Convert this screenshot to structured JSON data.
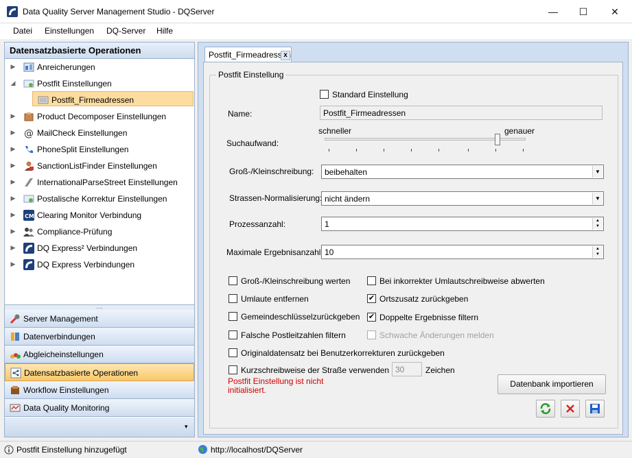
{
  "window": {
    "title": "Data Quality Server Management Studio - DQServer",
    "minimize": "—",
    "maximize": "☐",
    "close": "✕"
  },
  "menu": [
    "Datei",
    "Einstellungen",
    "DQ-Server",
    "Hilfe"
  ],
  "left": {
    "header": "Datensatzbasierte Operationen",
    "tree": [
      {
        "label": "Anreicherungen",
        "icon": "enrichment-icon",
        "expanded": false
      },
      {
        "label": "Postfit Einstellungen",
        "icon": "postfit-icon",
        "expanded": true
      },
      {
        "label": "Postfit_Firmeadressen",
        "icon": "document-icon",
        "child": true,
        "selected": true
      },
      {
        "label": "Product Decomposer Einstellungen",
        "icon": "product-icon",
        "expanded": false
      },
      {
        "label": "MailCheck Einstellungen",
        "icon": "at-icon",
        "expanded": false
      },
      {
        "label": "PhoneSplit Einstellungen",
        "icon": "phone-icon",
        "expanded": false
      },
      {
        "label": "SanctionListFinder Einstellungen",
        "icon": "person-icon",
        "expanded": false
      },
      {
        "label": "InternationalParseStreet Einstellungen",
        "icon": "street-icon",
        "expanded": false
      },
      {
        "label": "Postalische Korrektur Einstellungen",
        "icon": "postal-icon",
        "expanded": false
      },
      {
        "label": "Clearing Monitor Verbindung",
        "icon": "cm-icon",
        "expanded": false
      },
      {
        "label": "Compliance-Prüfung",
        "icon": "users-icon",
        "expanded": false
      },
      {
        "label": "DQ Express² Verbindungen",
        "icon": "dq-express-icon",
        "expanded": false
      },
      {
        "label": "DQ Express Verbindungen",
        "icon": "dq-express-icon",
        "expanded": false
      }
    ],
    "splitter": "....",
    "nav": [
      {
        "label": "Server Management",
        "icon": "wrench-icon",
        "selected": false
      },
      {
        "label": "Datenverbindungen",
        "icon": "database-icon",
        "selected": false
      },
      {
        "label": "Abgleicheinstellungen",
        "icon": "compare-icon",
        "selected": false
      },
      {
        "label": "Datensatzbasierte Operationen",
        "icon": "record-ops-icon",
        "selected": true
      },
      {
        "label": "Workflow Einstellungen",
        "icon": "workflow-icon",
        "selected": false
      },
      {
        "label": "Data Quality Monitoring",
        "icon": "monitoring-icon",
        "selected": false
      }
    ],
    "nav_more": "▾"
  },
  "tab": {
    "label": "Postfit_Firmeadressen",
    "close": "x"
  },
  "form": {
    "group_title": "Postfit Einstellung",
    "standard_label": "Standard Einstellung",
    "standard_checked": false,
    "name_label": "Name:",
    "name_value": "Postfit_Firmeadressen",
    "effort_label": "Suchaufwand:",
    "slider_left": "schneller",
    "slider_right": "genauer",
    "slider_value": 0.86,
    "case_label": "Groß-/Kleinschreibung:",
    "case_value": "beibehalten",
    "street_label": "Strassen-Normalisierung:",
    "street_value": "nicht ändern",
    "process_label": "Prozessanzahl:",
    "process_value": "1",
    "max_label": "Maximale Ergebnisanzahl:",
    "max_value": "10",
    "checks": [
      {
        "label": "Groß-/Kleinschreibung werten",
        "checked": false,
        "disabled": false
      },
      {
        "label": "Bei inkorrekter Umlautschreibweise abwerten",
        "checked": false,
        "disabled": false
      },
      {
        "label": "Umlaute entfernen",
        "checked": false,
        "disabled": false
      },
      {
        "label": "Ortszusatz zurückgeben",
        "checked": true,
        "disabled": false
      },
      {
        "label": "Gemeindeschlüsselzurückgeben",
        "checked": false,
        "disabled": false
      },
      {
        "label": "Doppelte Ergebnisse filtern",
        "checked": true,
        "disabled": false
      },
      {
        "label": "Falsche Postleitzahlen filtern",
        "checked": false,
        "disabled": false
      },
      {
        "label": "Schwache Änderungen melden",
        "checked": false,
        "disabled": true
      },
      {
        "label": "Originaldatensatz bei Benutzerkorrekturen zurückgeben",
        "checked": false,
        "disabled": false
      },
      {
        "label": "Kurzschreibweise der Straße verwenden ab",
        "checked": false,
        "disabled": false
      }
    ],
    "short_value": "30",
    "short_unit": "Zeichen",
    "error_line1": "Postfit Einstellung ist nicht",
    "error_line2": "initialisiert.",
    "error_color": "#d00000",
    "import_button": "Datenbank importieren",
    "check_mark": "✔"
  },
  "status": {
    "message": "Postfit Einstellung hinzugefügt",
    "url": "http://localhost/DQServer"
  }
}
